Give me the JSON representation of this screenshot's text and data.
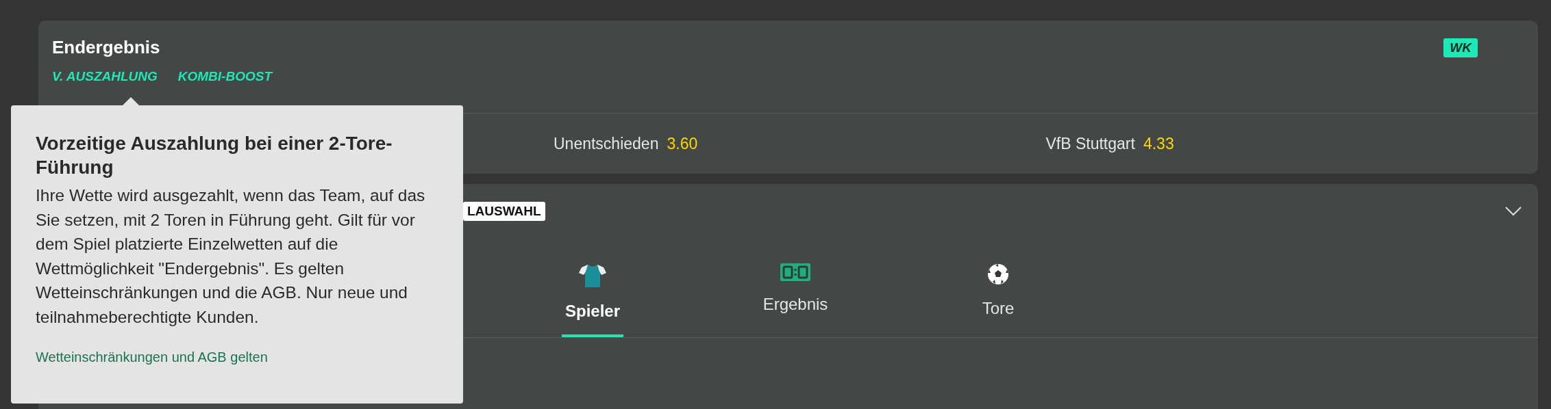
{
  "result_card": {
    "title": "Endergebnis",
    "tags": [
      "V. AUSZAHLUNG",
      "KOMBI-BOOST"
    ],
    "badge": "WK",
    "odds": [
      {
        "label": "Unentschieden",
        "price": "3.60"
      },
      {
        "label": "VfB Stuttgart",
        "price": "4.33"
      }
    ]
  },
  "market_card": {
    "header_badge": "LAUSWAHL",
    "expanded": true,
    "tabs": [
      {
        "label": "Spieler",
        "kind": "shirt",
        "selected": true
      },
      {
        "label": "Ergebnis",
        "kind": "scoreboard",
        "selected": false
      },
      {
        "label": "Tore",
        "kind": "ball",
        "selected": false
      }
    ]
  },
  "tooltip": {
    "title": "Vorzeitige Auszahlung bei einer 2-Tore-Führung",
    "body": "Ihre Wette wird ausgezahlt, wenn das Team, auf das Sie setzen, mit 2 Toren in Führung geht. Gilt für vor dem Spiel platzierte Einzelwetten auf die Wettmöglichkeit \"Endergebnis\". Es gelten Wetteinschränkungen und die AGB. Nur neue und teilnahmeberechtigte Kunden.",
    "link": "Wetteinschränkungen und AGB gelten"
  }
}
